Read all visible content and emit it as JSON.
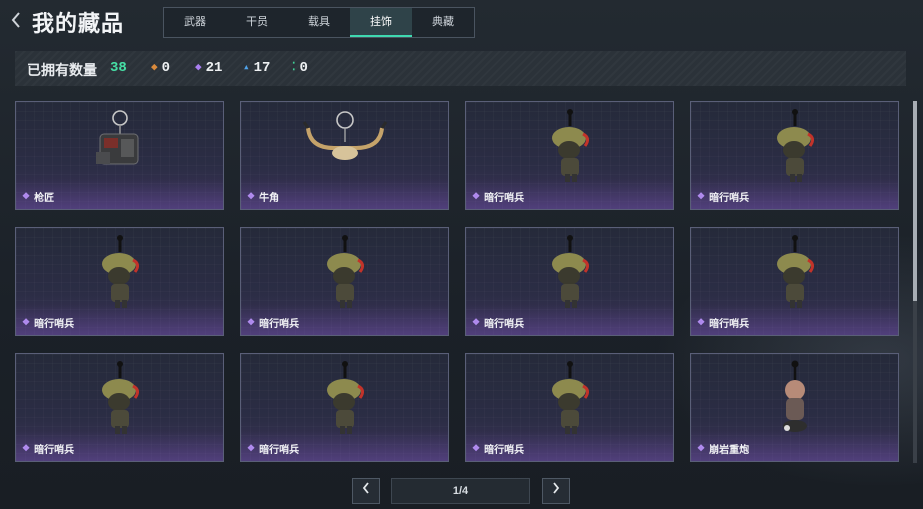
{
  "header": {
    "back_icon": "chevron-left-icon",
    "title": "我的藏品"
  },
  "tabs": [
    {
      "label": "武器",
      "active": false
    },
    {
      "label": "干员",
      "active": false
    },
    {
      "label": "载具",
      "active": false
    },
    {
      "label": "挂饰",
      "active": true
    },
    {
      "label": "典藏",
      "active": false
    }
  ],
  "stats": {
    "owned_label": "已拥有数量",
    "owned_count": "38",
    "owned_color": "#46e0a6",
    "rarities": [
      {
        "icon": "orange-diamond-icon",
        "color": "#d98a3c",
        "count": "0"
      },
      {
        "icon": "purple-diamond-icon",
        "color": "#a97ff0",
        "count": "21"
      },
      {
        "icon": "blue-diamond-icon",
        "color": "#4fa3ea",
        "count": "17"
      },
      {
        "icon": "green-diamond-icon",
        "color": "#3fcf96",
        "count": "0"
      }
    ]
  },
  "items": [
    {
      "name": "枪匠",
      "rarity": "purple"
    },
    {
      "name": "牛角",
      "rarity": "purple"
    },
    {
      "name": "暗行哨兵",
      "rarity": "purple"
    },
    {
      "name": "暗行哨兵",
      "rarity": "purple"
    },
    {
      "name": "暗行哨兵",
      "rarity": "purple"
    },
    {
      "name": "暗行哨兵",
      "rarity": "purple"
    },
    {
      "name": "暗行哨兵",
      "rarity": "purple"
    },
    {
      "name": "暗行哨兵",
      "rarity": "purple"
    },
    {
      "name": "暗行哨兵",
      "rarity": "purple"
    },
    {
      "name": "暗行哨兵",
      "rarity": "purple"
    },
    {
      "name": "暗行哨兵",
      "rarity": "purple"
    },
    {
      "name": "崩岩重炮",
      "rarity": "purple"
    }
  ],
  "pagination": {
    "prev_icon": "chevron-left-icon",
    "next_icon": "chevron-right-icon",
    "indicator": "1/4"
  }
}
